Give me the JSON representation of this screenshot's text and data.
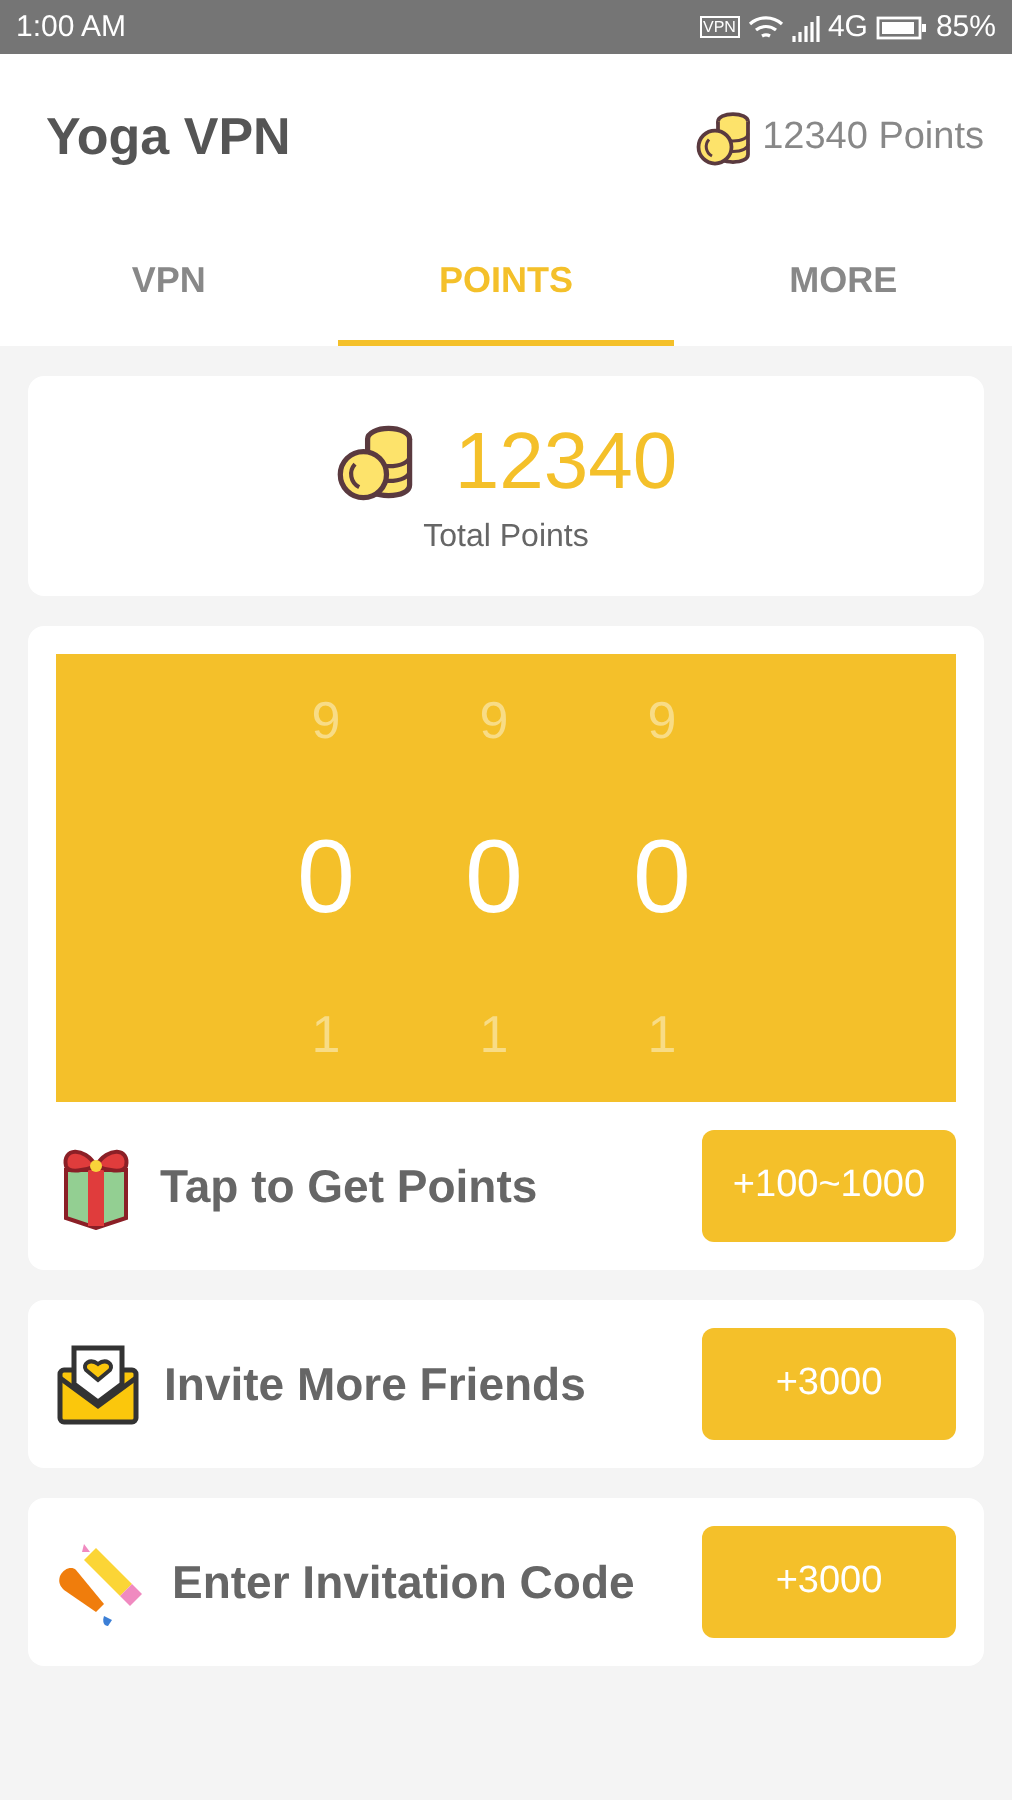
{
  "status_bar": {
    "time": "1:00 AM",
    "vpn_badge": "VPN",
    "network": "4G",
    "battery": "85%"
  },
  "header": {
    "title": "Yoga VPN",
    "points": "12340 Points"
  },
  "tabs": [
    {
      "label": "VPN",
      "selected": false
    },
    {
      "label": "POINTS",
      "selected": true
    },
    {
      "label": "MORE",
      "selected": false
    }
  ],
  "total": {
    "value": "12340",
    "label": "Total Points"
  },
  "slot_machine": {
    "reels": [
      {
        "above": "9",
        "current": "0",
        "below": "1"
      },
      {
        "above": "9",
        "current": "0",
        "below": "1"
      },
      {
        "above": "9",
        "current": "0",
        "below": "1"
      }
    ]
  },
  "actions": [
    {
      "kind": "gift",
      "label": "Tap to Get Points",
      "button": "+100~1000"
    },
    {
      "kind": "invite",
      "label": "Invite More Friends",
      "button": "+3000"
    },
    {
      "kind": "code",
      "label": "Enter Invitation Code",
      "button": "+3000"
    }
  ]
}
